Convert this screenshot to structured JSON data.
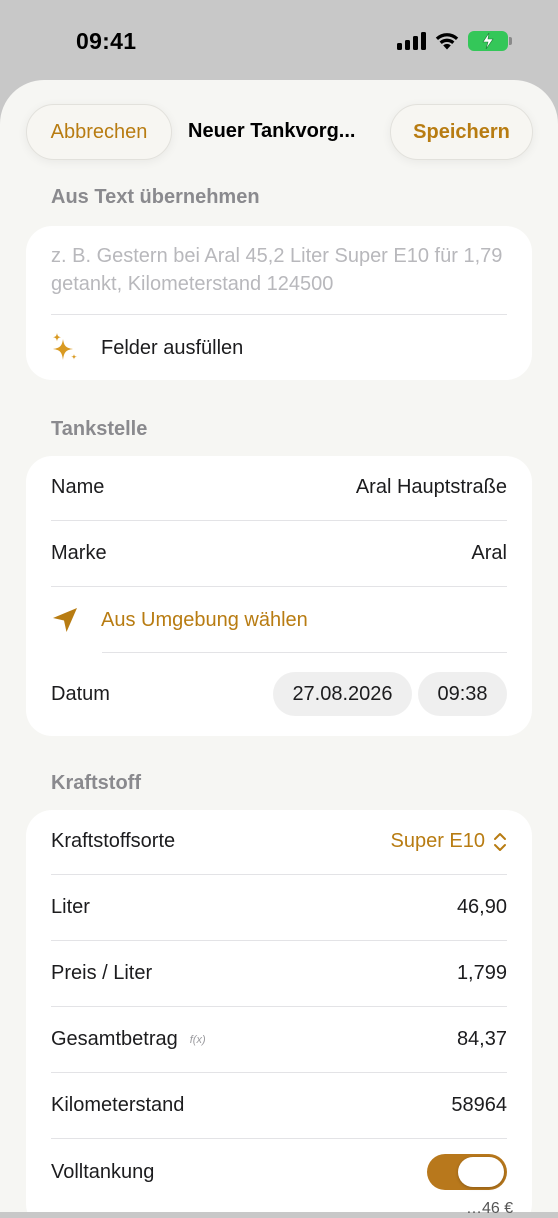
{
  "status_bar": {
    "time": "09:41"
  },
  "nav": {
    "cancel_label": "Abbrechen",
    "title": "Neuer Tankvorg...",
    "save_label": "Speichern"
  },
  "from_text": {
    "header": "Aus Text übernehmen",
    "placeholder": "z. B. Gestern bei Aral 45,2 Liter Super E10 für 1,79 getankt, Kilometerstand 124500",
    "fill_label": "Felder ausfüllen",
    "fill_icon": "sparkles-icon"
  },
  "station": {
    "header": "Tankstelle",
    "name_label": "Name",
    "name_value": "Aral Hauptstraße",
    "brand_label": "Marke",
    "brand_value": "Aral",
    "nearby_label": "Aus Umgebung wählen",
    "nearby_icon": "location-arrow-icon",
    "date_label": "Datum",
    "date_value": "27.08.2026",
    "time_value": "09:38"
  },
  "fuel": {
    "header": "Kraftstoff",
    "type_label": "Kraftstoffsorte",
    "type_value": "Super E10",
    "liters_label": "Liter",
    "liters_value": "46,90",
    "price_label": "Preis / Liter",
    "price_value": "1,799",
    "total_label": "Gesamtbetrag",
    "total_formula_badge": "f(x)",
    "total_value": "84,37",
    "odometer_label": "Kilometerstand",
    "odometer_value": "58964",
    "full_tank_label": "Volltankung",
    "full_tank_on": true
  },
  "peek_text": "…46 €",
  "colors": {
    "accent": "#b87c12",
    "toggle_on": "#b8781c",
    "battery": "#34c759"
  }
}
